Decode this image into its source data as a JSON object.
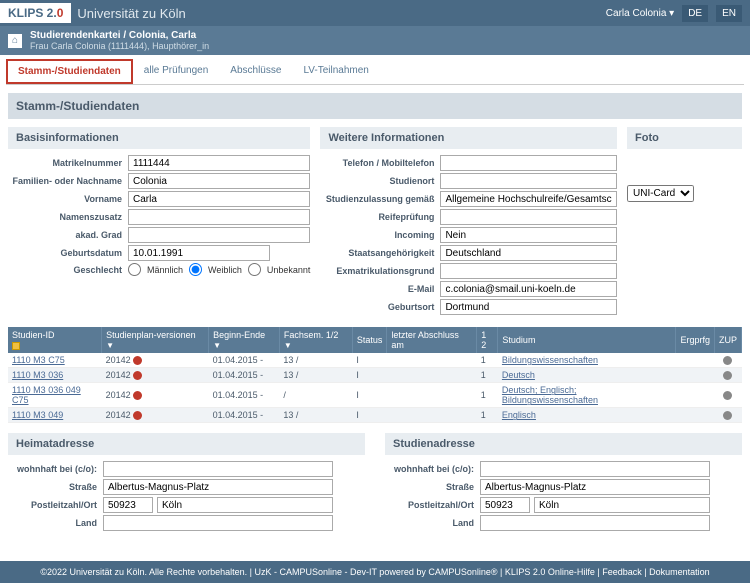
{
  "header": {
    "logo_text": "KLIPS 2.",
    "logo_suffix": "0",
    "university": "Universität zu Köln",
    "user": "Carla Colonia ▾",
    "lang_de": "DE",
    "lang_en": "EN"
  },
  "breadcrumb": {
    "title": "Studierendenkartei / Colonia, Carla",
    "sub": "Frau Carla Colonia (1111444), Haupthörer_in"
  },
  "tabs": {
    "t1": "Stamm-/Studiendaten",
    "t2": "alle Prüfungen",
    "t3": "Abschlüsse",
    "t4": "LV-Teilnahmen"
  },
  "page_title": "Stamm-/Studiendaten",
  "basis": {
    "title": "Basisinformationen",
    "matrikel_label": "Matrikelnummer",
    "matrikel": "1111444",
    "nachname_label": "Familien- oder Nachname",
    "nachname": "Colonia",
    "vorname_label": "Vorname",
    "vorname": "Carla",
    "namenszusatz_label": "Namenszusatz",
    "namenszusatz": "",
    "akadgrad_label": "akad. Grad",
    "akadgrad": "",
    "geburt_label": "Geburtsdatum",
    "geburt": "10.01.1991",
    "geschlecht_label": "Geschlecht",
    "g_m": "Männlich",
    "g_w": "Weiblich",
    "g_u": "Unbekannt"
  },
  "weitere": {
    "title": "Weitere Informationen",
    "telefon_label": "Telefon / Mobiltelefon",
    "telefon": "",
    "studienort_label": "Studienort",
    "studienort": "",
    "zulass_label": "Studienzulassung gemäß",
    "zulass": "Allgemeine Hochschulreife/Gesamtschule",
    "reife_label": "Reifeprüfung",
    "reife": "",
    "incoming_label": "Incoming",
    "incoming": "Nein",
    "staat_label": "Staatsangehörigkeit",
    "staat": "Deutschland",
    "exmat_label": "Exmatrikulationsgrund",
    "exmat": "",
    "email_label": "E-Mail",
    "email": "c.colonia@smail.uni-koeln.de",
    "gebort_label": "Geburtsort",
    "gebort": "Dortmund"
  },
  "foto": {
    "title": "Foto",
    "select": "UNI-Card"
  },
  "table": {
    "h_id": "Studien-ID",
    "h_plan": "Studienplan-versionen",
    "h_beginn": "Beginn-Ende",
    "h_fachsem": "Fachsem. 1/2",
    "h_status": "Status",
    "h_abschl": "letzter Abschluss am",
    "h_12": "1  2",
    "h_studium": "Studium",
    "h_erg": "Ergprfg",
    "h_zup": "ZUP",
    "rows": [
      {
        "id": "1110 M3 C75",
        "plan": "20142",
        "beg": "01.04.2015 -",
        "fs": "13 /",
        "st": "I",
        "c": "1",
        "stud": "Bildungswissenschaften"
      },
      {
        "id": "1110 M3 036",
        "plan": "20142",
        "beg": "01.04.2015 -",
        "fs": "13 /",
        "st": "I",
        "c": "1",
        "stud": "Deutsch"
      },
      {
        "id": "1110 M3 036 049 C75",
        "plan": "20142",
        "beg": "01.04.2015 -",
        "fs": "/",
        "st": "I",
        "c": "1",
        "stud": "Deutsch; Englisch; Bildungswissenschaften"
      },
      {
        "id": "1110 M3 049",
        "plan": "20142",
        "beg": "01.04.2015 -",
        "fs": "13 /",
        "st": "I",
        "c": "1",
        "stud": "Englisch"
      }
    ]
  },
  "heimat": {
    "title": "Heimatadresse",
    "co_label": "wohnhaft bei (c/o):",
    "co": "",
    "strasse_label": "Straße",
    "strasse": "Albertus-Magnus-Platz",
    "plz_label": "Postleitzahl/Ort",
    "plz": "50923",
    "ort": "Köln",
    "land_label": "Land",
    "land": ""
  },
  "studien": {
    "title": "Studienadresse",
    "co_label": "wohnhaft bei (c/o):",
    "co": "",
    "strasse_label": "Straße",
    "strasse": "Albertus-Magnus-Platz",
    "plz_label": "Postleitzahl/Ort",
    "plz": "50923",
    "ort": "Köln",
    "land_label": "Land",
    "land": ""
  },
  "footer": {
    "text": "©2022 Universität zu Köln. Alle Rechte vorbehalten. | UzK - CAMPUSonline - Dev-IT powered by CAMPUSonline® | KLIPS 2.0 Online-Hilfe | Feedback | Dokumentation"
  }
}
